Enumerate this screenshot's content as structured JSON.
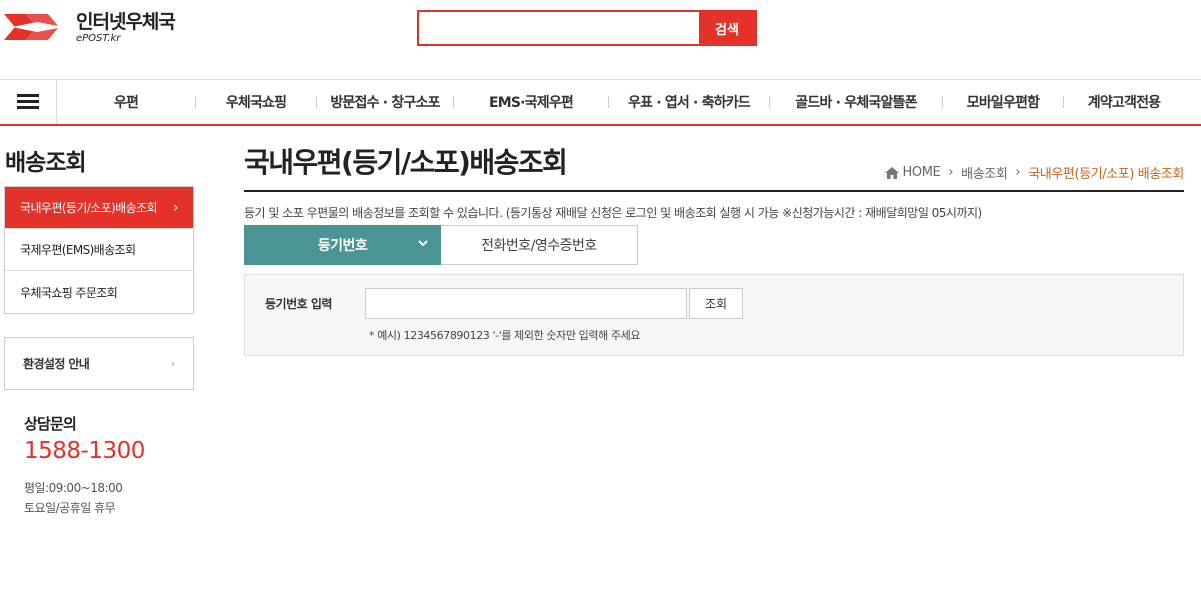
{
  "header": {
    "logo_title": "인터넷우체국",
    "logo_sub": "ePOST.kr",
    "search_placeholder": "",
    "search_button": "검색"
  },
  "gnb": {
    "items": [
      "우편",
      "우체국쇼핑",
      "방문접수 · 창구소포",
      "EMS·국제우편",
      "우표 · 엽서 · 축하카드",
      "골드바 · 우체국알뜰폰",
      "모바일우편함",
      "계약고객전용"
    ]
  },
  "lnb": {
    "title": "배송조회",
    "items": [
      {
        "label": "국내우편(등기/소포)배송조회",
        "active": true
      },
      {
        "label": "국제우편(EMS)배송조회",
        "active": false
      },
      {
        "label": "우체국쇼핑 주문조회",
        "active": false
      }
    ],
    "env_label": "환경설정 안내"
  },
  "cs": {
    "title": "상담문의",
    "phone": "1588-1300",
    "hours1": "평일:09:00~18:00",
    "hours2": "토요일/공휴일 휴무"
  },
  "content": {
    "page_title": "국내우편(등기/소포)배송조회",
    "breadcrumb": [
      "HOME",
      "배송조회",
      "국내우편(등기/소포) 배송조회"
    ],
    "description": "등기 및 소포 우편물의 배송정보를 조회할 수 있습니다. (등기통상 재배달 신청은 로그인 및 배송조회 실행 시 가능 ※신청가능시간 : 재배달희망일 05시까지)",
    "tabs": [
      "등기번호",
      "전화번호/영수증번호"
    ],
    "form_label": "등기번호 입력",
    "input_value": "",
    "submit_label": "조회",
    "hint": "* 예시) 1234567890123 '-'를 제외한 숫자만 입력해 주세요"
  },
  "colors": {
    "accent": "#e4322b",
    "tab_active": "#4a9496",
    "breadcrumb_current": "#c9641b"
  }
}
